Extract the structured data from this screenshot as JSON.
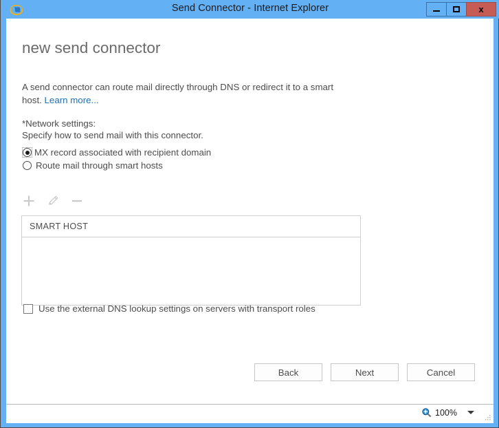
{
  "window": {
    "title": "Send Connector - Internet Explorer",
    "icon": "internet-explorer-icon",
    "frame_color": "#63b0f5",
    "caption": {
      "minimize_label": "Minimize",
      "maximize_label": "Maximize",
      "close_label": "x",
      "close_color": "#c75b55"
    }
  },
  "page": {
    "title": "new send connector",
    "description": "A send connector can route mail directly through DNS or redirect it to a smart host.",
    "learn_more": "Learn more...",
    "link_color": "#1f6fb5"
  },
  "network_settings": {
    "label": "*Network settings:",
    "sublabel": "Specify how to send mail with this connector.",
    "options": [
      {
        "label": "MX record associated with recipient domain",
        "selected": true,
        "focused": true
      },
      {
        "label": "Route mail through smart hosts",
        "selected": false,
        "focused": false
      }
    ]
  },
  "toolbar": {
    "items": [
      {
        "name": "add-icon",
        "glyph": "+",
        "enabled": false
      },
      {
        "name": "edit-pencil-icon",
        "glyph": "pencil",
        "enabled": false
      },
      {
        "name": "remove-icon",
        "glyph": "-",
        "enabled": false
      }
    ]
  },
  "smart_host_list": {
    "columns": [
      "SMART HOST"
    ],
    "rows": []
  },
  "external_dns": {
    "label": "Use the external DNS lookup settings on servers with transport roles",
    "checked": false
  },
  "buttons": {
    "back": "Back",
    "next": "Next",
    "cancel": "Cancel"
  },
  "statusbar": {
    "zoom_level": "100%",
    "zoom_icon": "magnifier-icon",
    "caret_icon": "chevron-down-icon",
    "grip_icon": "resize-grip-icon"
  }
}
